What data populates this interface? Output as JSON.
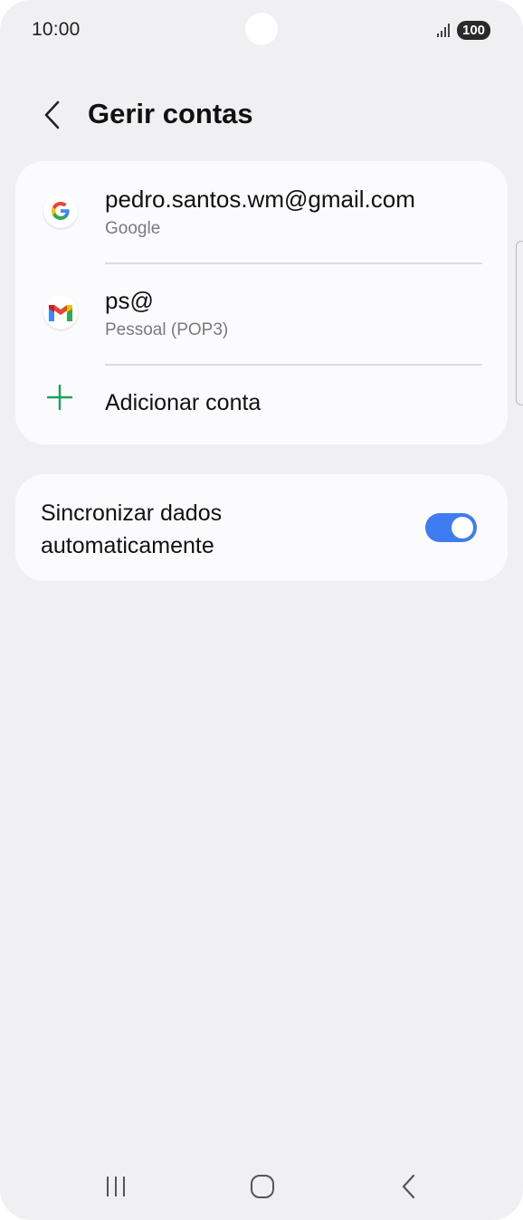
{
  "status_bar": {
    "time": "10:00",
    "battery": "100",
    "signal_icon": "signal-icon"
  },
  "header": {
    "back_icon": "chevron-left-icon",
    "title": "Gerir contas"
  },
  "accounts": [
    {
      "name": "pedro.santos.wm@gmail.com",
      "type": "Google",
      "icon": "google-icon"
    },
    {
      "name": "ps@",
      "type": "Pessoal (POP3)",
      "icon": "gmail-icon"
    }
  ],
  "add_account": {
    "label": "Adicionar conta",
    "icon": "plus-icon"
  },
  "sync": {
    "label_line1": "Sincronizar dados",
    "label_line2": "automaticamente",
    "enabled": true
  },
  "nav_bar": {
    "recents_icon": "recents-icon",
    "home_icon": "home-icon",
    "back_icon": "back-icon"
  },
  "colors": {
    "background": "#f0f0f2",
    "card": "#fbfbfd",
    "accent_green": "#1e9e5a",
    "toggle_on": "#3f7cf1"
  }
}
